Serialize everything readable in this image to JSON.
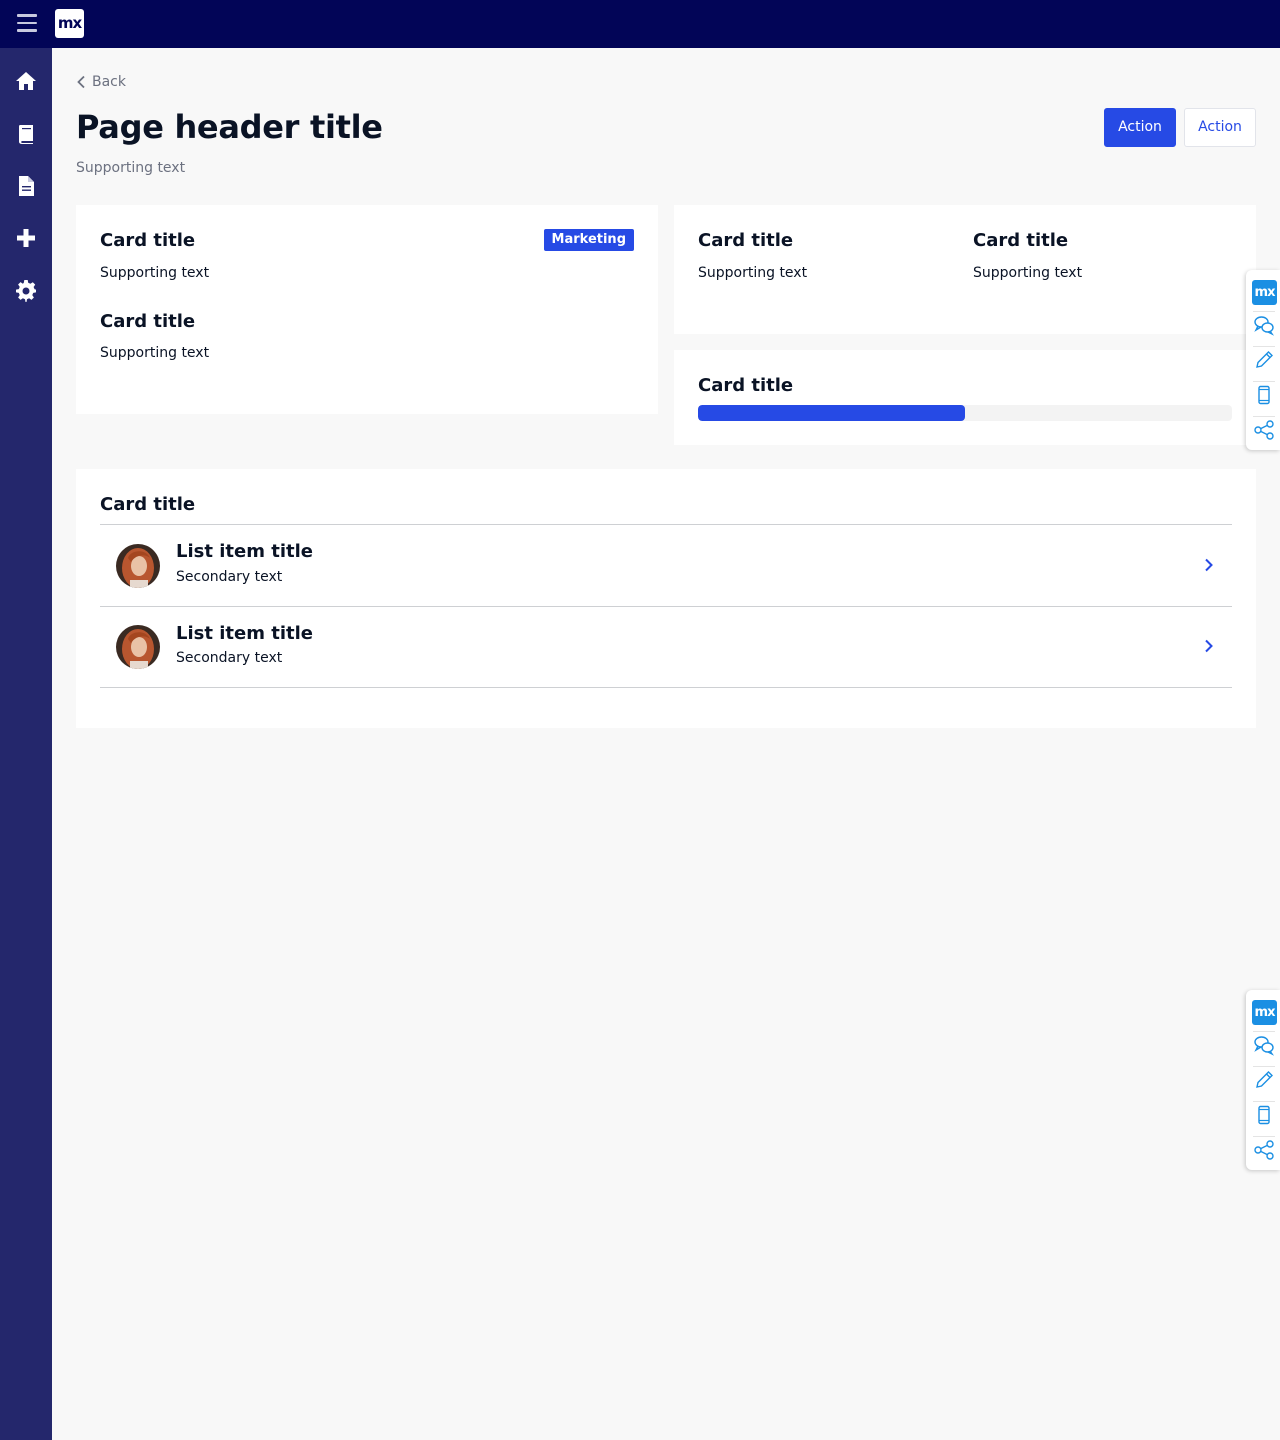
{
  "topbar": {
    "logo_text": "mx",
    "menu_icon": "hamburger-menu-icon"
  },
  "sidebar": {
    "items": [
      {
        "icon": "home-icon"
      },
      {
        "icon": "book-icon"
      },
      {
        "icon": "file-icon"
      },
      {
        "icon": "plus-icon"
      },
      {
        "icon": "gear-icon"
      }
    ]
  },
  "page": {
    "back_label": "Back",
    "title": "Page header title",
    "subtitle": "Supporting text",
    "primary_action": "Action",
    "secondary_action": "Action"
  },
  "card1": {
    "title1": "Card title",
    "sub1": "Supporting text",
    "badge": "Marketing",
    "title2": "Card title",
    "sub2": "Supporting text"
  },
  "card2": {
    "left_title": "Card title",
    "left_sub": "Supporting text",
    "right_title": "Card title",
    "right_sub": "Supporting text"
  },
  "card3": {
    "title": "Card title",
    "progress": 0.5
  },
  "card4": {
    "title": "Card title",
    "items": [
      {
        "title": "List item title",
        "secondary": "Secondary text"
      },
      {
        "title": "List item title",
        "secondary": "Secondary text"
      }
    ]
  },
  "dock": {
    "logo_text": "mx",
    "items": [
      "chat-icon",
      "pencil-icon",
      "mobile-icon",
      "share-icon"
    ]
  },
  "colors": {
    "brand_dark": "#020557",
    "sidebar": "#24276c",
    "primary": "#264ae5",
    "dock_accent": "#1b8fe3"
  }
}
